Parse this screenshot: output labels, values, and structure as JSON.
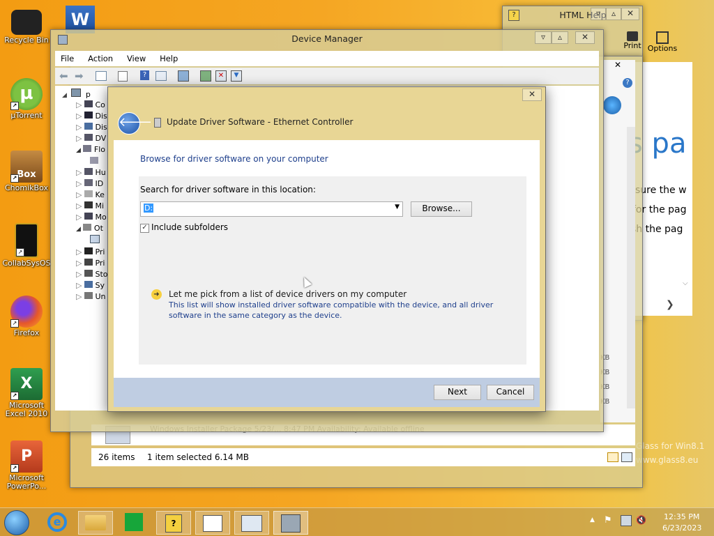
{
  "desktop": {
    "icons": [
      {
        "label": "Recycle Bin"
      },
      {
        "label": "µTorrent"
      },
      {
        "label": "ChomikBox"
      },
      {
        "label": "CollabSysOS"
      },
      {
        "label": "Firefox"
      },
      {
        "label": "Microsoft Excel 2010"
      },
      {
        "label": "Microsoft PowerPo..."
      }
    ],
    "watermark": "Glass for Win8.1\nwww.glass8.eu"
  },
  "html_help": {
    "title": "HTML Help",
    "print_label": "Print",
    "options_label": "Options",
    "content_lines": [
      "s pa",
      "sure the w",
      "for the pag",
      "sh the pag"
    ]
  },
  "explorer_back": {
    "status_items": "26 items",
    "status_selected": "1 item selected  6.14 MB",
    "file_row": "Windows Installer Package   5/23/... 8:47 PM   Availability: Available offline",
    "size_fragments": [
      "KB",
      "KB",
      "KB",
      "KB"
    ]
  },
  "device_manager": {
    "title": "Device Manager",
    "menu": [
      "File",
      "Action",
      "View",
      "Help"
    ],
    "tree_root": "p",
    "tree_items": [
      "Co",
      "Dis",
      "Dis",
      "DV",
      "Flo",
      "",
      "Hu",
      "ID",
      "Ke",
      "Mi",
      "Mo",
      "Ot",
      "",
      "Pri",
      "Pri",
      "Sto",
      "Sy",
      "Un"
    ]
  },
  "dialog": {
    "title": "Update Driver Software - Ethernet Controller",
    "heading": "Browse for driver software on your computer",
    "search_label": "Search for driver software in this location:",
    "path_value": "D:",
    "browse_label": "Browse...",
    "include_subfolders_label": "Include subfolders",
    "include_subfolders_checked": true,
    "pick_title": "Let me pick from a list of device drivers on my computer",
    "pick_desc_1": "This list will show installed driver software compatible with the device, and all driver",
    "pick_desc_2": "software in the same category as the device.",
    "next_label": "Next",
    "cancel_label": "Cancel"
  },
  "taskbar": {
    "time": "12:35 PM",
    "date": "6/23/2023"
  },
  "colors": {
    "desktop_orange": "#f39c12",
    "dialog_link_blue": "#1e3f8c",
    "footer_blue": "#bfcde2"
  }
}
